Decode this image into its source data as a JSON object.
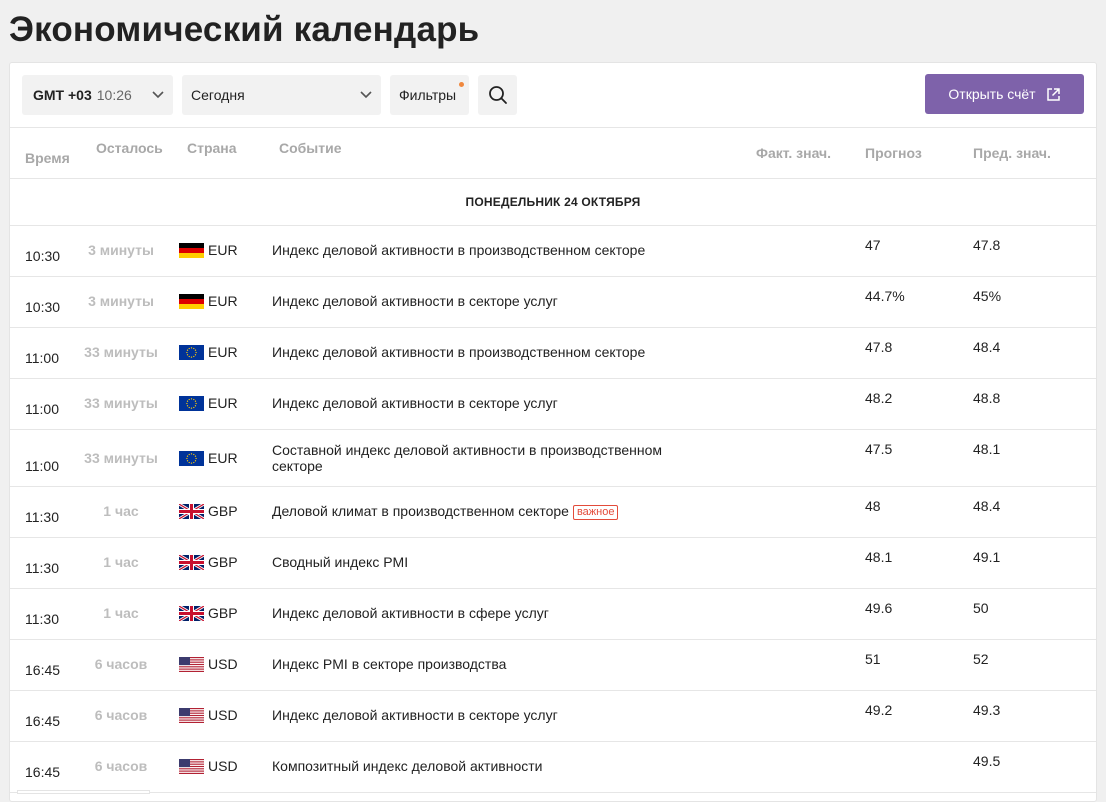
{
  "title": "Экономический календарь",
  "toolbar": {
    "tz_label": "GMT +03",
    "tz_time": "10:26",
    "date_select": "Сегодня",
    "filters_label": "Фильтры",
    "open_account_label": "Открыть счёт",
    "accent_color": "#7e62aa",
    "dot_color": "#f0883e"
  },
  "columns": {
    "time": "Время",
    "left": "Осталось",
    "country": "Страна",
    "event": "Событие",
    "actual": "Факт. знач.",
    "forecast": "Прогноз",
    "previous": "Пред. знач."
  },
  "day_header": "ПОНЕДЕЛЬНИК 24 ОКТЯБРЯ",
  "rows": [
    {
      "time": "10:30",
      "left": "3 минуты",
      "flag": "de",
      "currency": "EUR",
      "event": "Индекс деловой активности в производственном секторе",
      "badge": "",
      "forecast": "47",
      "previous": "47.8"
    },
    {
      "time": "10:30",
      "left": "3 минуты",
      "flag": "de",
      "currency": "EUR",
      "event": "Индекс деловой активности в секторе услуг",
      "badge": "",
      "forecast": "44.7%",
      "previous": "45%"
    },
    {
      "time": "11:00",
      "left": "33 минуты",
      "flag": "eu",
      "currency": "EUR",
      "event": "Индекс деловой активности в производственном секторе",
      "badge": "",
      "forecast": "47.8",
      "previous": "48.4"
    },
    {
      "time": "11:00",
      "left": "33 минуты",
      "flag": "eu",
      "currency": "EUR",
      "event": "Индекс деловой активности в секторе услуг",
      "badge": "",
      "forecast": "48.2",
      "previous": "48.8"
    },
    {
      "time": "11:00",
      "left": "33 минуты",
      "flag": "eu",
      "currency": "EUR",
      "event": "Составной индекс деловой активности в производственном секторе",
      "badge": "",
      "forecast": "47.5",
      "previous": "48.1",
      "tall": true
    },
    {
      "time": "11:30",
      "left": "1 час",
      "flag": "gb",
      "currency": "GBP",
      "event": "Деловой климат в производственном секторе",
      "badge": "важное",
      "forecast": "48",
      "previous": "48.4"
    },
    {
      "time": "11:30",
      "left": "1 час",
      "flag": "gb",
      "currency": "GBP",
      "event": "Сводный индекс PMI",
      "badge": "",
      "forecast": "48.1",
      "previous": "49.1"
    },
    {
      "time": "11:30",
      "left": "1 час",
      "flag": "gb",
      "currency": "GBP",
      "event": "Индекс деловой активности в сфере услуг",
      "badge": "",
      "forecast": "49.6",
      "previous": "50"
    },
    {
      "time": "16:45",
      "left": "6 часов",
      "flag": "us",
      "currency": "USD",
      "event": "Индекс PMI в секторе производства",
      "badge": "",
      "forecast": "51",
      "previous": "52"
    },
    {
      "time": "16:45",
      "left": "6 часов",
      "flag": "us",
      "currency": "USD",
      "event": "Индекс деловой активности в секторе услуг",
      "badge": "",
      "forecast": "49.2",
      "previous": "49.3"
    },
    {
      "time": "16:45",
      "left": "6 часов",
      "flag": "us",
      "currency": "USD",
      "event": "Композитный индекс деловой активности",
      "badge": "",
      "forecast": "",
      "previous": "49.5"
    }
  ]
}
